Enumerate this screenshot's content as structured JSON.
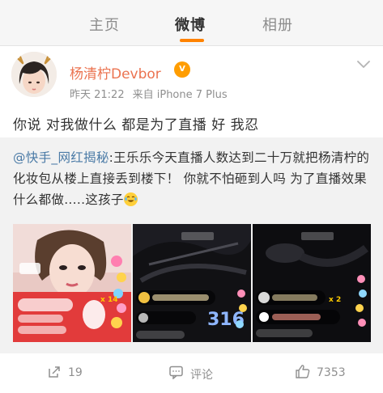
{
  "tabs": [
    {
      "label": "主页",
      "active": false
    },
    {
      "label": "微博",
      "active": true
    },
    {
      "label": "相册",
      "active": false
    }
  ],
  "accent_color": "#ff8200",
  "post": {
    "author": "杨清柠Devbor",
    "badge_icon": "vip-badge-icon",
    "time": "昨天 21:22",
    "source": "来自 iPhone 7 Plus",
    "text": "你说 对我做什么 都是为了直播 好 我忍"
  },
  "repost": {
    "mention": "@快手_网红揭秘",
    "text": ":王乐乐今天直播人数达到二十万就把杨清柠的化妆包从楼上直接丢到楼下！  你就不怕砸到人吗 为了直播效果什么都做.....这孩子",
    "emoji_icon": "laugh-cry-emoji-icon"
  },
  "actions": {
    "reposts": "19",
    "comments": "评论",
    "likes": "7353"
  },
  "thumbnails": [
    {
      "overlay": "x 14"
    },
    {
      "overlay": "316"
    },
    {
      "overlay": "x 2"
    }
  ]
}
